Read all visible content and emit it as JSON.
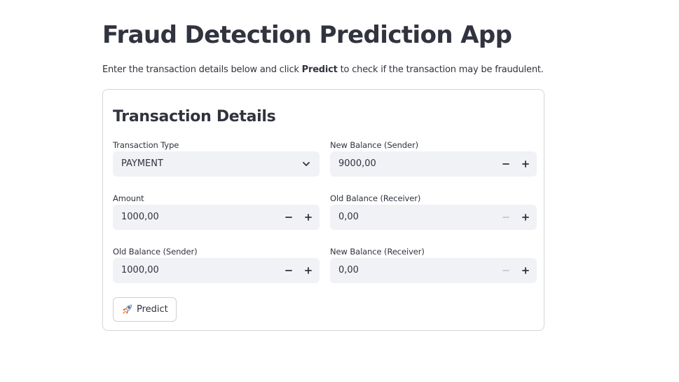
{
  "page": {
    "title": "Fraud Detection Prediction App",
    "intro_before": "Enter the transaction details below and click ",
    "intro_bold": "Predict",
    "intro_after": " to check if the transaction may be fraudulent."
  },
  "form": {
    "heading": "Transaction Details",
    "fields": [
      {
        "label": "Transaction Type",
        "value": "PAYMENT",
        "kind": "select",
        "icon": "chevron-down-icon"
      },
      {
        "label": "New Balance (Sender)",
        "value": "9000,00",
        "kind": "number",
        "minus_enabled": true
      },
      {
        "label": "Amount",
        "value": "1000,00",
        "kind": "number",
        "minus_enabled": true
      },
      {
        "label": "Old Balance (Receiver)",
        "value": "0,00",
        "kind": "number",
        "minus_enabled": false
      },
      {
        "label": "Old Balance (Sender)",
        "value": "1000,00",
        "kind": "number",
        "minus_enabled": true
      },
      {
        "label": "New Balance (Receiver)",
        "value": "0,00",
        "kind": "number",
        "minus_enabled": false
      }
    ],
    "predict_button": {
      "label": "Predict",
      "icon": "rocket-icon"
    }
  },
  "colors": {
    "text": "#31333f",
    "input_bg": "#f0f2f6",
    "border": "#d6d6d9",
    "disabled_icon": "#c5c7cd"
  }
}
